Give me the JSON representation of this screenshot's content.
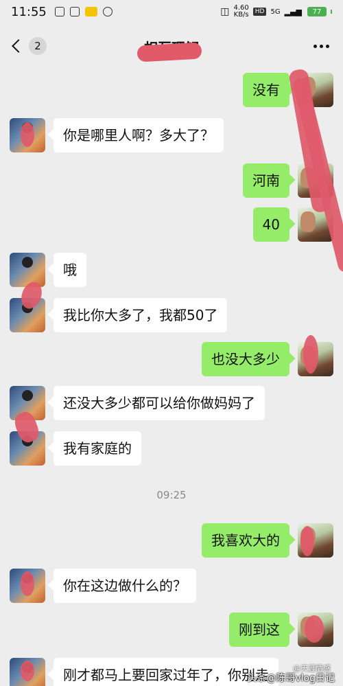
{
  "status_bar": {
    "time": "11:55",
    "speed_value": "4.60",
    "speed_unit": "KB/s",
    "hd": "HD",
    "signal": "5G",
    "battery": "77"
  },
  "header": {
    "unread_count": "2",
    "title": "相互理解"
  },
  "messages": [
    {
      "side": "right",
      "text": "没有"
    },
    {
      "side": "left",
      "text": "你是哪里人啊？多大了？"
    },
    {
      "side": "right",
      "text": "河南"
    },
    {
      "side": "right",
      "text": "40"
    },
    {
      "side": "left",
      "text": "哦"
    },
    {
      "side": "left",
      "text": "我比你大多了，我都50了"
    },
    {
      "side": "right",
      "text": "也没大多少"
    },
    {
      "side": "left",
      "text": "还没大多少都可以给你做妈妈了"
    },
    {
      "side": "left",
      "text": "我有家庭的"
    },
    {
      "side": "right",
      "text": "我喜欢大的"
    },
    {
      "side": "left",
      "text": "你在这边做什么的？"
    },
    {
      "side": "right",
      "text": "刚到这"
    },
    {
      "side": "left",
      "text": "刚才都马上要回家过年了，你别走"
    }
  ],
  "timestamp": "09:25",
  "watermark": "头条@陈哥vlog日记",
  "watermark_small": "@天涯情感",
  "colors": {
    "background": "#ededed",
    "sent_bubble": "#95ec69",
    "received_bubble": "#ffffff",
    "scribble": "#e05a6a",
    "battery": "#4caf50"
  },
  "icons": [
    "back-icon",
    "more-icon"
  ]
}
